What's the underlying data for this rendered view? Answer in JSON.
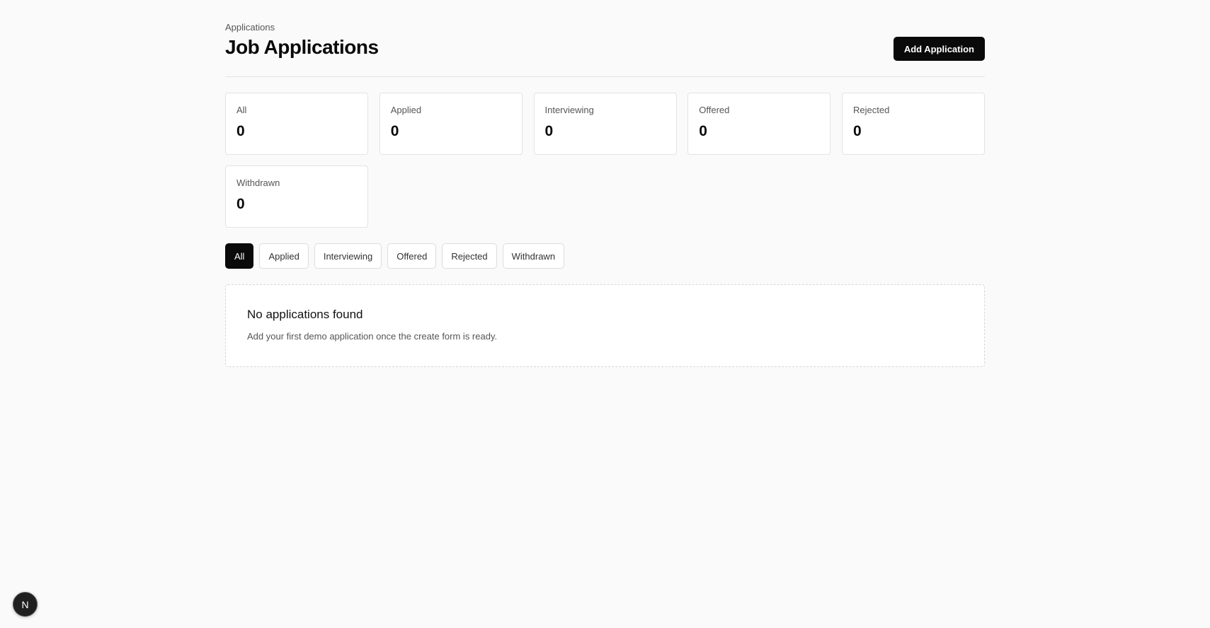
{
  "header": {
    "eyebrow": "Applications",
    "title": "Job Applications",
    "add_button_label": "Add Application"
  },
  "stats": [
    {
      "label": "All",
      "value": "0"
    },
    {
      "label": "Applied",
      "value": "0"
    },
    {
      "label": "Interviewing",
      "value": "0"
    },
    {
      "label": "Offered",
      "value": "0"
    },
    {
      "label": "Rejected",
      "value": "0"
    },
    {
      "label": "Withdrawn",
      "value": "0"
    }
  ],
  "filters": [
    {
      "label": "All",
      "active": true
    },
    {
      "label": "Applied",
      "active": false
    },
    {
      "label": "Interviewing",
      "active": false
    },
    {
      "label": "Offered",
      "active": false
    },
    {
      "label": "Rejected",
      "active": false
    },
    {
      "label": "Withdrawn",
      "active": false
    }
  ],
  "empty_state": {
    "title": "No applications found",
    "description": "Add your first demo application once the create form is ready."
  },
  "dev_badge": {
    "icon": "nextjs-logo-icon",
    "glyph": "N"
  },
  "colors": {
    "background": "#fafafa",
    "primary": "#0a0a0a",
    "card": "#ffffff",
    "border": "#e3e3e3"
  }
}
